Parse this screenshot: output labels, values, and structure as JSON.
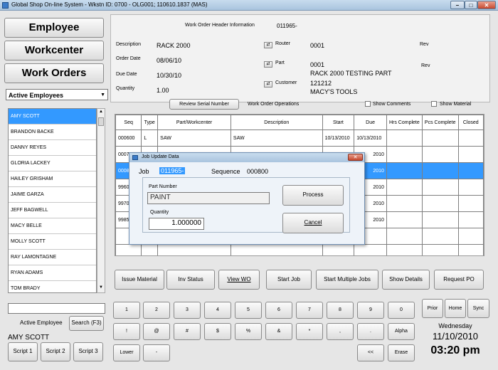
{
  "window": {
    "title": "Global Shop On-line System - Wkstn ID: 0700 - OLG001; 110610.1837 (MAS)",
    "min": "–",
    "max": "□",
    "close": "✕"
  },
  "left": {
    "buttons": [
      "Employee",
      "Workcenter",
      "Work Orders"
    ],
    "dropdown": "Active Employees",
    "employees": [
      "AMY SCOTT",
      "BRANDON BACKE",
      "DANNY REYES",
      "GLORIA LACKEY",
      "HAILEY GRISHAM",
      "JAIME GARZA",
      "JEFF BAGWELL",
      "MACY BELLE",
      "MOLLY SCOTT",
      "RAY LAMONTAGNE",
      "RYAN ADAMS",
      "TOM BRADY"
    ],
    "active_employee_label": "Active Employee",
    "search_button": "Search (F3)",
    "active_employee_name": "AMY SCOTT",
    "scripts": [
      "Script 1",
      "Script 2",
      "Script 3"
    ]
  },
  "header": {
    "section_title": "Work Order Header Information",
    "wo_number": "011965-",
    "description_label": "Description",
    "description": "RACK 2000",
    "order_date_label": "Order Date",
    "order_date": "08/06/10",
    "due_date_label": "Due Date",
    "due_date": "10/30/10",
    "quantity_label": "Quantity",
    "quantity": "1.00",
    "router_label": "Router",
    "router": "0001",
    "rev1_label": "Rev",
    "part_label": "Part",
    "part": "0001",
    "part_desc": "RACK 2000 TESTING PART",
    "rev2_label": "Rev",
    "customer_label": "Customer",
    "customer_id": "121212",
    "customer_name": "MACY'S TOOLS"
  },
  "ops": {
    "review_serial": "Review Serial Number",
    "title": "Work Order Operations",
    "show_comments": "Show Comments",
    "show_material": "Show Material",
    "columns": [
      "Seq",
      "Type",
      "Part/Workcenter",
      "Description",
      "Start",
      "Due",
      "Hrs Complete",
      "Pcs Complete",
      "Closed"
    ],
    "rows": [
      [
        "000600",
        "L",
        "SAW",
        "SAW",
        "10/13/2010",
        "10/13/2010",
        "",
        "",
        ""
      ],
      [
        "0007",
        "",
        "",
        "",
        "",
        "2010",
        "",
        "",
        ""
      ],
      [
        "0008",
        "",
        "",
        "",
        "",
        "2010",
        "",
        "",
        ""
      ],
      [
        "9960",
        "",
        "",
        "",
        "",
        "2010",
        "",
        "",
        ""
      ],
      [
        "9970",
        "",
        "",
        "",
        "",
        "2010",
        "",
        "",
        ""
      ],
      [
        "9985",
        "",
        "",
        "",
        "",
        "2010",
        "",
        "",
        ""
      ],
      [
        "",
        "",
        "",
        "",
        "",
        "",
        "",
        "",
        ""
      ],
      [
        "",
        "",
        "",
        "",
        "",
        "",
        "",
        "",
        ""
      ]
    ]
  },
  "actions": [
    "Issue Material",
    "Inv Status",
    "View WO",
    "Start Job",
    "Start Multiple Jobs",
    "Show Details",
    "Request PO"
  ],
  "dialog": {
    "title": "Job Update Data",
    "job_label": "Job",
    "job_value": "011965-",
    "sequence_label": "Sequence",
    "sequence_value": "000800",
    "part_number_label": "Part Number",
    "part_number_value": "PAINT",
    "quantity_label": "Quantity",
    "quantity_value": "1.000000",
    "process_button": "Process",
    "cancel_button": "Cancel"
  },
  "keypad": {
    "row1": [
      "1",
      "2",
      "3",
      "4",
      "5",
      "6",
      "7",
      "8",
      "9",
      "0"
    ],
    "row2": [
      "!",
      "@",
      "#",
      "$",
      "%",
      "&",
      "*",
      ",",
      ".",
      "Alpha"
    ],
    "lower": "Lower",
    "dash": "-",
    "back": "<<",
    "erase": "Erase"
  },
  "nav": {
    "prior": "Prior",
    "home": "Home",
    "sync": "Sync"
  },
  "clock": {
    "day": "Wednesday",
    "date": "11/10/2010",
    "time": "03:20 pm"
  }
}
